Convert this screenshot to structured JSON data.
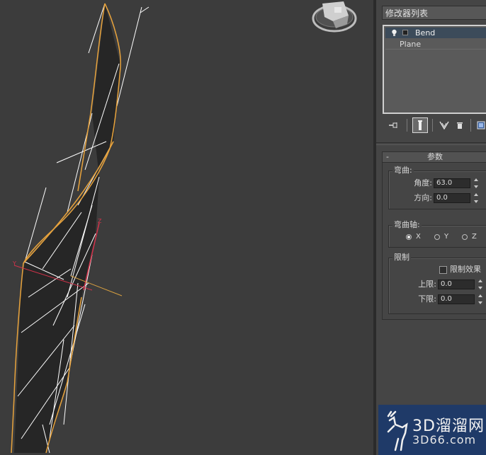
{
  "modifier_panel": {
    "dropdown_label": "修改器列表",
    "stack_items": [
      {
        "label": "Bend",
        "selected": true
      },
      {
        "label": "Plane",
        "selected": false
      }
    ]
  },
  "toolbar": {
    "pin_icon": "pin-stack-icon",
    "show_end_result_icon": "show-end-result-icon",
    "make_unique_icon": "make-unique-icon",
    "remove_modifier_icon": "remove-modifier-icon",
    "configure_icon": "configure-sets-icon"
  },
  "rollout": {
    "collapse_symbol": "-",
    "title": "参数",
    "bend_group": {
      "label": "弯曲:",
      "angle_label": "角度:",
      "angle_value": "63.0",
      "direction_label": "方向:",
      "direction_value": "0.0"
    },
    "axis_group": {
      "label": "弯曲轴:",
      "options": [
        "X",
        "Y",
        "Z"
      ],
      "selected": "X"
    },
    "limits_group": {
      "label": "限制",
      "limit_effect_label": "限制效果",
      "limit_effect_checked": false,
      "upper_label": "上限:",
      "upper_value": "0.0",
      "lower_label": "下限:",
      "lower_value": "0.0"
    }
  },
  "watermark": {
    "text": "3D溜溜网",
    "sub": "3D66.com"
  },
  "colors": {
    "viewport_bg": "#3c3c3c",
    "panel_bg": "#454545",
    "selection_orange": "#e8a33c",
    "wire_white": "#ffffff",
    "gizmo_red": "#d2324a",
    "watermark_bg": "#1f3a68"
  }
}
